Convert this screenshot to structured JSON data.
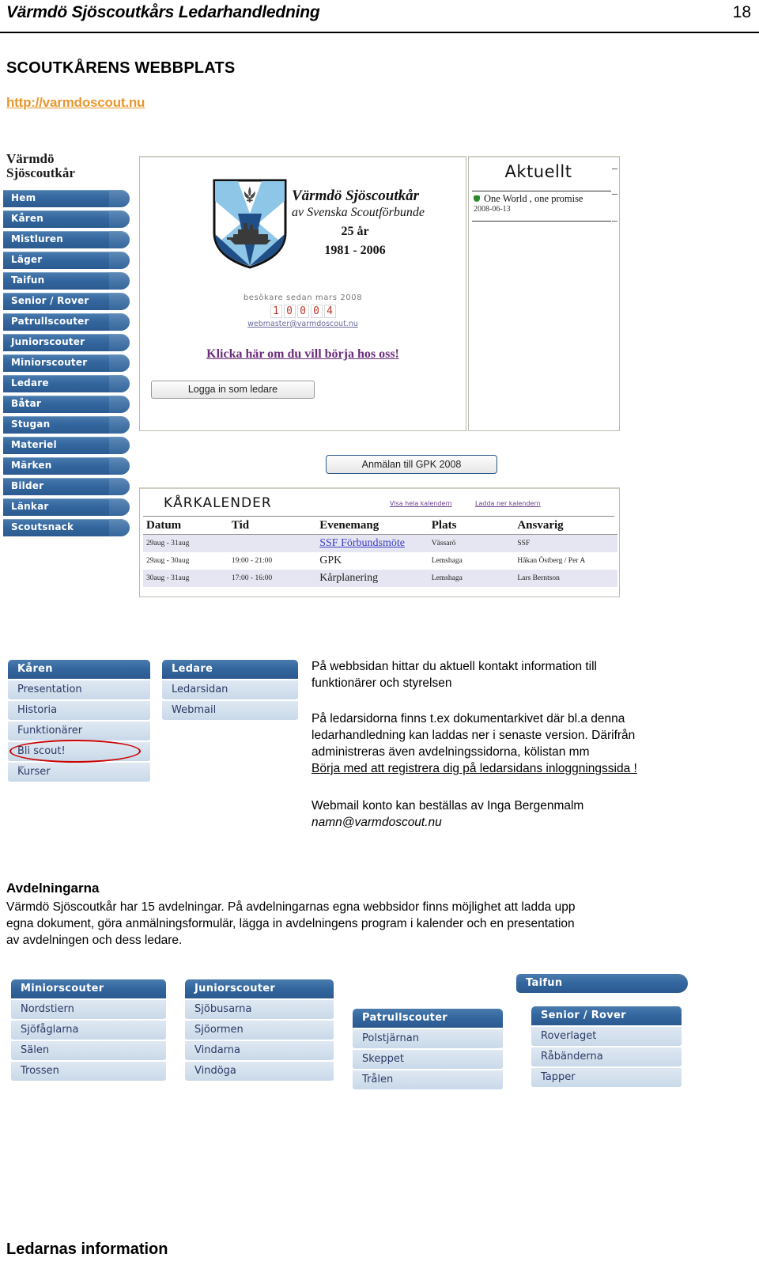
{
  "doc": {
    "running_title": "Värmdö Sjöscoutkårs Ledarhandledning",
    "page_number": "18",
    "section_heading": "SCOUTKÅRENS WEBBPLATS",
    "url": "http://varmdoscout.nu",
    "bottom_heading": "Ledarnas information"
  },
  "colors": {
    "nav_blue": "#2b5a8f",
    "nav_blue_light": "#4a7cae",
    "menu_item_bg": "#cfdcea",
    "link_orange": "#e8972e",
    "annotation_red": "#cc0000",
    "counter_red": "#c0392b"
  },
  "website": {
    "logo_line1": "Värmdö",
    "logo_line2": "Sjöscoutkår",
    "nav_items": [
      "Hem",
      "Kåren",
      "Mistluren",
      "Läger",
      "Taifun",
      "Senior / Rover",
      "Patrullscouter",
      "Juniorscouter",
      "Miniorscouter",
      "Ledare",
      "Båtar",
      "Stugan",
      "Materiel",
      "Märken",
      "Bilder",
      "Länkar",
      "Scoutsnack"
    ],
    "banner": {
      "title": "Värmdö Sjöscoutkår",
      "subtitle": "av Svenska Scoutförbunde",
      "anniversary": "25 år",
      "years": "1981 - 2006"
    },
    "counter_label": "besökare sedan mars 2008",
    "counter_digits": [
      "1",
      "0",
      "0",
      "0",
      "4"
    ],
    "webmaster_mail": "webmaster@varmdoscout.nu",
    "join_link": "Klicka här om du vill börja hos oss!",
    "login_button": "Logga in som ledare",
    "gpk_button": "Anmälan till GPK 2008",
    "aktuellt": {
      "title": "Aktuellt",
      "items": [
        {
          "headline": "One World , one promise",
          "date": "2008-06-13"
        }
      ]
    },
    "calendar": {
      "title": "KÅRKALENDER",
      "link_show": "Visa hela kalendern",
      "link_download": "Ladda ner kalendern",
      "columns": [
        "Datum",
        "Tid",
        "Evenemang",
        "Plats",
        "Ansvarig"
      ],
      "rows": [
        {
          "datum": "29aug - 31aug",
          "tid": "",
          "evenemang": "SSF Förbundsmöte",
          "evenemang_is_link": true,
          "plats": "Vässarö",
          "ansvarig": "SSF"
        },
        {
          "datum": "29aug - 30aug",
          "tid": "19:00 - 21:00",
          "evenemang": "GPK",
          "evenemang_is_link": false,
          "plats": "Lemshaga",
          "ansvarig": "Håkan Östberg / Per A"
        },
        {
          "datum": "30aug - 31aug",
          "tid": "17:00 - 16:00",
          "evenemang": "Kårplanering",
          "evenemang_is_link": false,
          "plats": "Lemshaga",
          "ansvarig": "Lars Berntson"
        }
      ]
    }
  },
  "menus": {
    "karen": {
      "header": "Kåren",
      "items": [
        "Presentation",
        "Historia",
        "Funktionärer",
        "Bli scout!",
        "Kurser"
      ],
      "highlighted_item": "Funktionärer"
    },
    "ledare": {
      "header": "Ledare",
      "items": [
        "Ledarsidan",
        "Webmail"
      ]
    },
    "miniorscouter": {
      "header": "Miniorscouter",
      "items": [
        "Nordstiern",
        "Sjöfåglarna",
        "Sälen",
        "Trossen"
      ]
    },
    "juniorscouter": {
      "header": "Juniorscouter",
      "items": [
        "Sjöbusarna",
        "Sjöormen",
        "Vindarna",
        "Vindöga"
      ]
    },
    "patrullscouter": {
      "header": "Patrullscouter",
      "items": [
        "Polstjärnan",
        "Skeppet",
        "Trålen"
      ]
    },
    "taifun": {
      "header": "Taifun"
    },
    "senior_rover": {
      "header": "Senior / Rover",
      "items": [
        "Roverlaget",
        "Råbänderna",
        "Tapper"
      ]
    }
  },
  "prose": {
    "p1_line1": "På webbsidan hittar du aktuell kontakt information till",
    "p1_line2": "funktionärer och styrelsen",
    "p2_line1": "På ledarsidorna finns t.ex dokumentarkivet där bl.a denna",
    "p2_line2": "ledarhandledning kan laddas ner i senaste version. Därifrån",
    "p2_line3": "administreras även avdelningssidorna, kölistan mm",
    "p2_line4_underlined": "Börja med att registrera dig på ledarsidans inloggningssida !",
    "p3_line1": "Webmail konto kan beställas av Inga Bergenmalm",
    "p3_line2_italic": "namn@varmdoscout.nu",
    "avdelningar_heading": "Avdelningarna",
    "avdelningar_line1": "Värmdö Sjöscoutkår har 15 avdelningar. På avdelningarnas egna webbsidor finns möjlighet att ladda upp",
    "avdelningar_line2": "egna dokument, göra anmälningsformulär,  lägga in avdelningens program i kalender och en presentation",
    "avdelningar_line3": "av avdelningen och dess ledare."
  }
}
